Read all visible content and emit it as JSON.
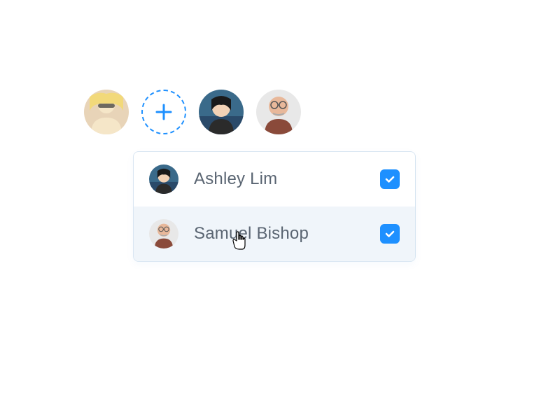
{
  "avatars": [
    {
      "name": "user-1"
    },
    {
      "name": "ashley-lim"
    },
    {
      "name": "samuel-bishop"
    }
  ],
  "dropdown": {
    "items": [
      {
        "name": "Ashley Lim",
        "checked": true,
        "hovered": false
      },
      {
        "name": "Samuel Bishop",
        "checked": true,
        "hovered": true
      }
    ]
  },
  "icons": {
    "plus": "plus-icon",
    "check": "check-icon",
    "cursor": "pointer-cursor-icon"
  },
  "colors": {
    "accent": "#1E90FF",
    "text": "#5a6572",
    "hover_bg": "#f0f5fa",
    "border": "#d9e6f2"
  }
}
